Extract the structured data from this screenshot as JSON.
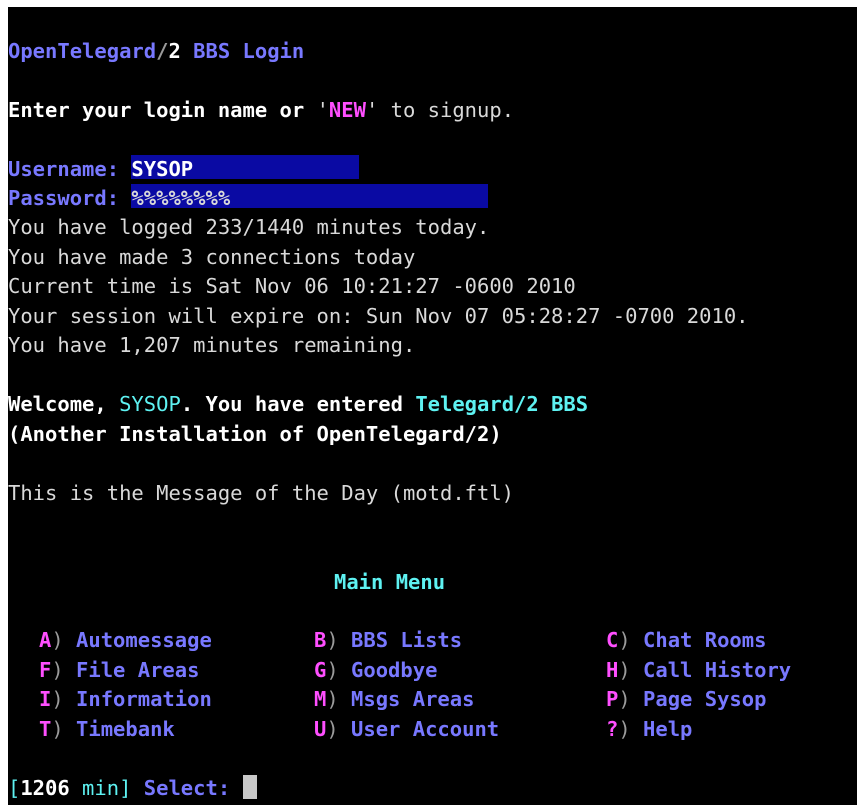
{
  "login": {
    "app_name": "OpenTelegard",
    "slash": "/",
    "version": "2",
    "title_suffix": " BBS Login",
    "prompt_pre": "Enter your login name or ",
    "quote": "'",
    "new_keyword": "NEW",
    "prompt_post": " to signup.",
    "username_label": "Username: ",
    "username_value": "SYSOP",
    "password_label": "Password: ",
    "password_mask": "%%%%%%%%"
  },
  "stats": {
    "logged": "You have logged 233/1440 minutes today.",
    "connections": "You have made 3 connections today",
    "current_time": "Current time is Sat Nov 06 10:21:27 -0600 2010",
    "expire": "Your session will expire on: Sun Nov 07 05:28:27 -0700 2010.",
    "remaining": "You have 1,207 minutes remaining."
  },
  "welcome": {
    "pre": "Welcome, ",
    "user": "SYSOP",
    "mid": ". You have entered ",
    "bbs": "Telegard/2 BBS",
    "install": "(Another Installation of OpenTelegard/2)",
    "motd": "This is the Message of the Day (motd.ftl)"
  },
  "menu": {
    "title": "Main Menu",
    "paren": ")",
    "rows": [
      [
        {
          "key": "A",
          "label": "Automessage"
        },
        {
          "key": "B",
          "label": "BBS Lists"
        },
        {
          "key": "C",
          "label": "Chat Rooms"
        }
      ],
      [
        {
          "key": "F",
          "label": "File Areas"
        },
        {
          "key": "G",
          "label": "Goodbye"
        },
        {
          "key": "H",
          "label": "Call History"
        }
      ],
      [
        {
          "key": "I",
          "label": "Information"
        },
        {
          "key": "M",
          "label": "Msgs Areas"
        },
        {
          "key": "P",
          "label": "Page Sysop"
        }
      ],
      [
        {
          "key": "T",
          "label": "Timebank"
        },
        {
          "key": "U",
          "label": "User Account"
        },
        {
          "key": "?",
          "label": "Help"
        }
      ]
    ]
  },
  "prompt": {
    "open": "[",
    "minutes": "1206",
    "unit": " min",
    "close": "]",
    "select": " Select: "
  },
  "colors": {
    "background": "#000000",
    "blue_text": "#7878ff",
    "cyan": "#5ef2f2",
    "magenta": "#ff4fff",
    "highlight": "#0a0aa3"
  }
}
